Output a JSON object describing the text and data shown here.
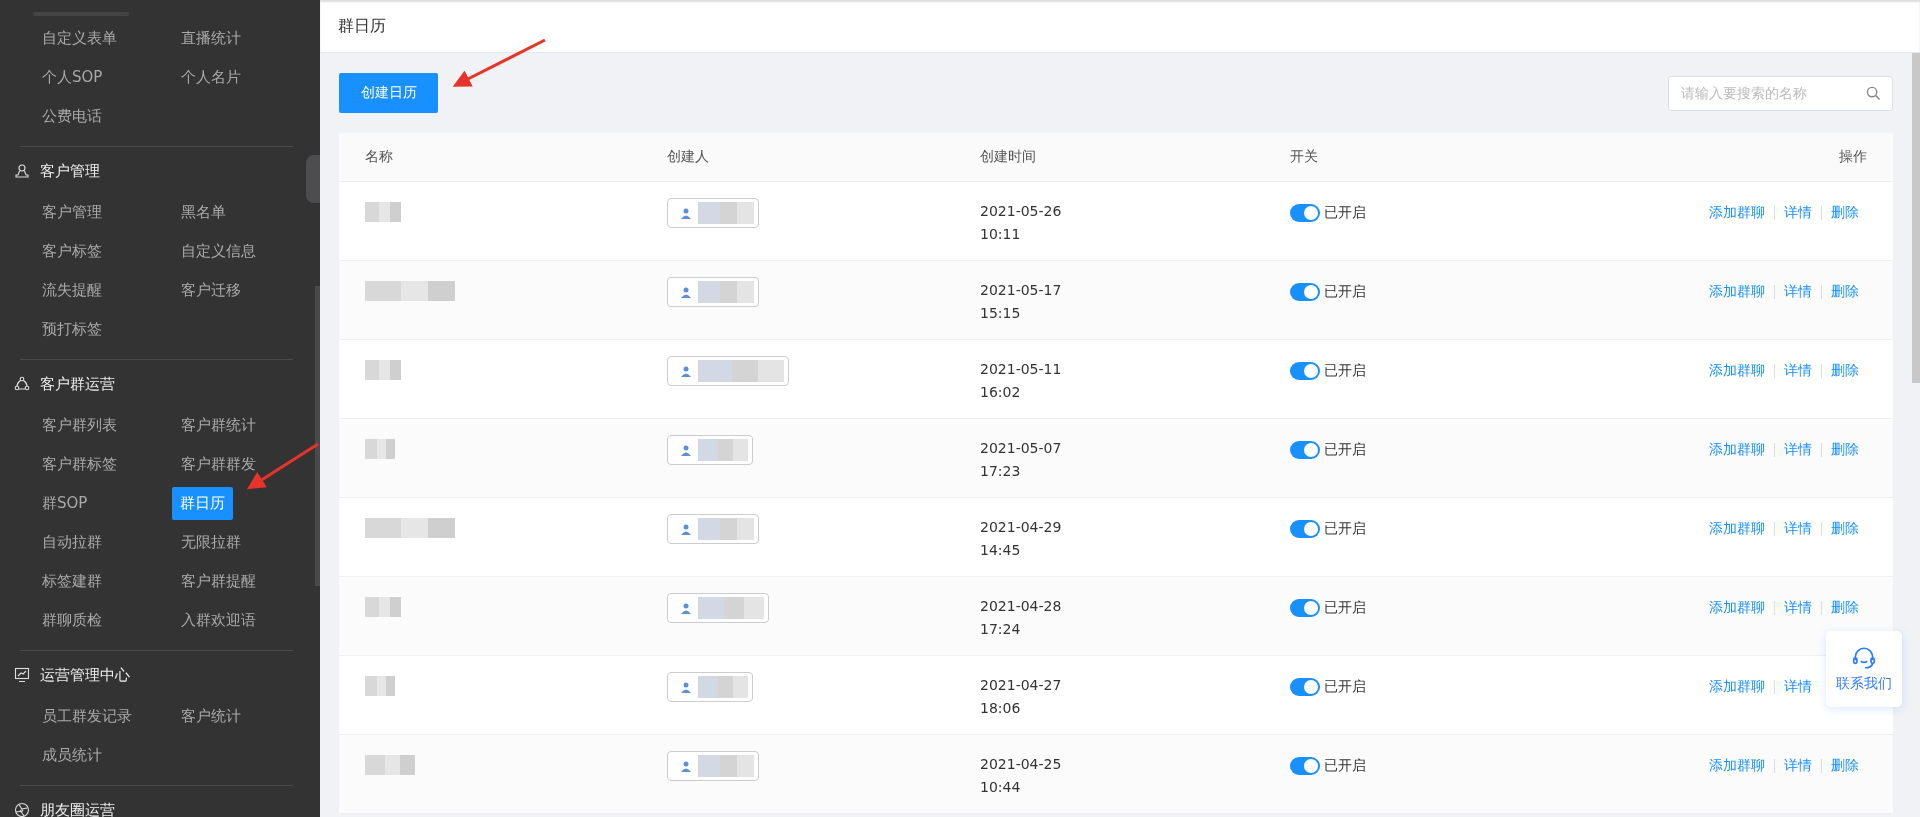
{
  "sidebar": {
    "sections": [
      {
        "items": [
          {
            "label": "自定义表单",
            "selected": false
          },
          {
            "label": "直播统计",
            "selected": false
          },
          {
            "label": "个人SOP",
            "selected": false
          },
          {
            "label": "个人名片",
            "selected": false
          },
          {
            "label": "公费电话",
            "selected": false
          }
        ]
      },
      {
        "title": "客户管理",
        "items": [
          {
            "label": "客户管理",
            "selected": false
          },
          {
            "label": "黑名单",
            "selected": false
          },
          {
            "label": "客户标签",
            "selected": false
          },
          {
            "label": "自定义信息",
            "selected": false
          },
          {
            "label": "流失提醒",
            "selected": false
          },
          {
            "label": "客户迁移",
            "selected": false
          },
          {
            "label": "预打标签",
            "selected": false
          }
        ]
      },
      {
        "title": "客户群运营",
        "items": [
          {
            "label": "客户群列表",
            "selected": false
          },
          {
            "label": "客户群统计",
            "selected": false
          },
          {
            "label": "客户群标签",
            "selected": false
          },
          {
            "label": "客户群群发",
            "selected": false
          },
          {
            "label": "群SOP",
            "selected": false
          },
          {
            "label": "群日历",
            "selected": true
          },
          {
            "label": "自动拉群",
            "selected": false
          },
          {
            "label": "无限拉群",
            "selected": false
          },
          {
            "label": "标签建群",
            "selected": false
          },
          {
            "label": "客户群提醒",
            "selected": false
          },
          {
            "label": "群聊质检",
            "selected": false
          },
          {
            "label": "入群欢迎语",
            "selected": false
          }
        ]
      },
      {
        "title": "运营管理中心",
        "items": [
          {
            "label": "员工群发记录",
            "selected": false
          },
          {
            "label": "客户统计",
            "selected": false
          },
          {
            "label": "成员统计",
            "selected": false
          }
        ]
      },
      {
        "title": "朋友圈运营"
      }
    ]
  },
  "page": {
    "title": "群日历"
  },
  "toolbar": {
    "create_button": "创建日历",
    "search": {
      "placeholder": "请输入要搜索的名称"
    }
  },
  "table": {
    "columns": [
      "名称",
      "创建人",
      "创建时间",
      "开关",
      "操作"
    ],
    "rows": [
      {
        "date": "2021-05-26",
        "time": "10:11",
        "on": true,
        "switch_label": "已开启",
        "actions": [
          "添加群聊",
          "详情",
          "删除"
        ]
      },
      {
        "date": "2021-05-17",
        "time": "15:15",
        "on": true,
        "switch_label": "已开启",
        "actions": [
          "添加群聊",
          "详情",
          "删除"
        ]
      },
      {
        "date": "2021-05-11",
        "time": "16:02",
        "on": true,
        "switch_label": "已开启",
        "actions": [
          "添加群聊",
          "详情",
          "删除"
        ]
      },
      {
        "date": "2021-05-07",
        "time": "17:23",
        "on": true,
        "switch_label": "已开启",
        "actions": [
          "添加群聊",
          "详情",
          "删除"
        ]
      },
      {
        "date": "2021-04-29",
        "time": "14:45",
        "on": true,
        "switch_label": "已开启",
        "actions": [
          "添加群聊",
          "详情",
          "删除"
        ]
      },
      {
        "date": "2021-04-28",
        "time": "17:24",
        "on": true,
        "switch_label": "已开启",
        "actions": [
          "添加群聊",
          "详情",
          "删除"
        ]
      },
      {
        "date": "2021-04-27",
        "time": "18:06",
        "on": true,
        "switch_label": "已开启",
        "actions": [
          "添加群聊",
          "详情"
        ]
      },
      {
        "date": "2021-04-25",
        "time": "10:44",
        "on": true,
        "switch_label": "已开启",
        "actions": [
          "添加群聊",
          "详情",
          "删除"
        ]
      }
    ]
  },
  "contact": {
    "label": "联系我们"
  }
}
